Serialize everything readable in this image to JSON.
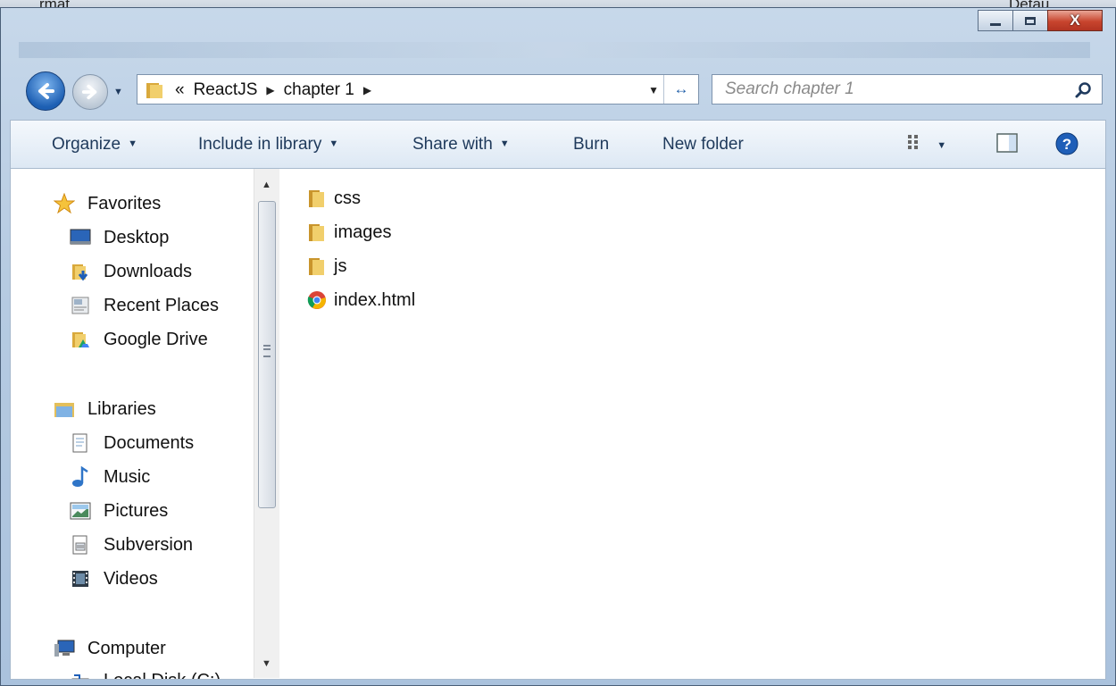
{
  "background_window": {
    "left_text": "rmat",
    "right_text": "Detau..."
  },
  "window": {
    "caption": {
      "minimize_icon": "minimize-icon",
      "maximize_icon": "maximize-icon",
      "close_label": "X"
    }
  },
  "navigation": {
    "back_icon": "back-arrow-icon",
    "forward_icon": "forward-arrow-icon"
  },
  "address_bar": {
    "overflow": "«",
    "breadcrumbs": [
      "ReactJS",
      "chapter 1"
    ],
    "separator": "▶",
    "refresh_icon": "refresh-icon"
  },
  "search": {
    "placeholder": "Search chapter 1"
  },
  "command_bar": {
    "organize": "Organize",
    "include_in_library": "Include in library",
    "share_with": "Share with",
    "burn": "Burn",
    "new_folder": "New folder",
    "view_icon": "view-options-icon",
    "preview_icon": "preview-pane-icon",
    "help_icon": "help-icon"
  },
  "nav_pane": {
    "favorites": {
      "label": "Favorites",
      "items": [
        {
          "label": "Desktop",
          "icon": "desktop-icon"
        },
        {
          "label": "Downloads",
          "icon": "downloads-icon"
        },
        {
          "label": "Recent Places",
          "icon": "recent-places-icon"
        },
        {
          "label": "Google Drive",
          "icon": "google-drive-icon"
        }
      ]
    },
    "libraries": {
      "label": "Libraries",
      "items": [
        {
          "label": "Documents",
          "icon": "documents-icon"
        },
        {
          "label": "Music",
          "icon": "music-icon"
        },
        {
          "label": "Pictures",
          "icon": "pictures-icon"
        },
        {
          "label": "Subversion",
          "icon": "subversion-icon"
        },
        {
          "label": "Videos",
          "icon": "videos-icon"
        }
      ]
    },
    "computer": {
      "label": "Computer",
      "items": [
        {
          "label": "Local Disk (C:)",
          "icon": "local-disk-icon"
        }
      ]
    }
  },
  "files": [
    {
      "name": "css",
      "type": "folder"
    },
    {
      "name": "images",
      "type": "folder"
    },
    {
      "name": "js",
      "type": "folder"
    },
    {
      "name": "index.html",
      "type": "chrome-html"
    }
  ],
  "colors": {
    "folder": "#e8c25a",
    "accent": "#1e395b",
    "close": "#c8452e"
  }
}
